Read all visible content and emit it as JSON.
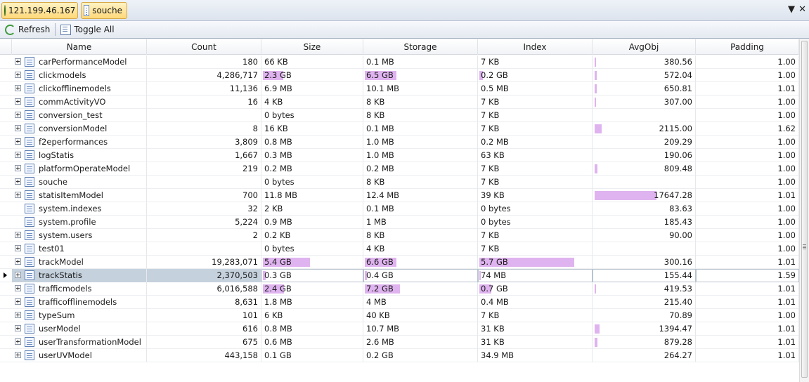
{
  "tabs": [
    {
      "label": "121.199.46.167",
      "icon": "server-globe-icon"
    },
    {
      "label": "souche",
      "icon": "database-icon"
    }
  ],
  "toolbar": {
    "refresh_label": "Refresh",
    "toggle_all_label": "Toggle All"
  },
  "columns": [
    "Name",
    "Count",
    "Size",
    "Storage",
    "Index",
    "AvgObj",
    "Padding"
  ],
  "selected_row": "trackStatis",
  "colors": {
    "bar": "#dfb3ef",
    "selected_row": "#c5d1dd",
    "tab_active": "#ffd97a"
  },
  "rows": [
    {
      "name": "carPerformanceModel",
      "count": "180",
      "size": "66 KB",
      "storage": "0.1 MB",
      "index": "7 KB",
      "avgobj": "380.56",
      "padding": "1.00",
      "expandable": true
    },
    {
      "name": "clickmodels",
      "count": "4,286,717",
      "size": "2.3 GB",
      "storage": "6.5 GB",
      "index": "0.2 GB",
      "avgobj": "572.04",
      "padding": "1.00",
      "expandable": true
    },
    {
      "name": "clickofflinemodels",
      "count": "11,136",
      "size": "6.9 MB",
      "storage": "10.1 MB",
      "index": "0.5 MB",
      "avgobj": "650.81",
      "padding": "1.01",
      "expandable": true
    },
    {
      "name": "commActivityVO",
      "count": "16",
      "size": "4 KB",
      "storage": "8 KB",
      "index": "7 KB",
      "avgobj": "307.00",
      "padding": "1.00",
      "expandable": true
    },
    {
      "name": "conversion_test",
      "count": "",
      "size": "0 bytes",
      "storage": "8 KB",
      "index": "7 KB",
      "avgobj": "",
      "padding": "1.00",
      "expandable": true
    },
    {
      "name": "conversionModel",
      "count": "8",
      "size": "16 KB",
      "storage": "0.1 MB",
      "index": "7 KB",
      "avgobj": "2115.00",
      "padding": "1.62",
      "expandable": true
    },
    {
      "name": "f2eperformances",
      "count": "3,809",
      "size": "0.8 MB",
      "storage": "1.0 MB",
      "index": "0.2 MB",
      "avgobj": "209.29",
      "padding": "1.00",
      "expandable": true
    },
    {
      "name": "logStatis",
      "count": "1,667",
      "size": "0.3 MB",
      "storage": "1.0 MB",
      "index": "63 KB",
      "avgobj": "190.06",
      "padding": "1.00",
      "expandable": true
    },
    {
      "name": "platformOperateModel",
      "count": "219",
      "size": "0.2 MB",
      "storage": "0.2 MB",
      "index": "7 KB",
      "avgobj": "809.48",
      "padding": "1.00",
      "expandable": true
    },
    {
      "name": "souche",
      "count": "",
      "size": "0 bytes",
      "storage": "8 KB",
      "index": "7 KB",
      "avgobj": "",
      "padding": "1.00",
      "expandable": true
    },
    {
      "name": "statisItemModel",
      "count": "700",
      "size": "11.8 MB",
      "storage": "12.4 MB",
      "index": "39 KB",
      "avgobj": "17647.28",
      "padding": "1.01",
      "expandable": true
    },
    {
      "name": "system.indexes",
      "count": "32",
      "size": "2 KB",
      "storage": "0.1 MB",
      "index": "0 bytes",
      "avgobj": "83.63",
      "padding": "1.00",
      "expandable": false
    },
    {
      "name": "system.profile",
      "count": "5,224",
      "size": "0.9 MB",
      "storage": "1 MB",
      "index": "0 bytes",
      "avgobj": "185.43",
      "padding": "1.00",
      "expandable": false
    },
    {
      "name": "system.users",
      "count": "2",
      "size": "0.2 KB",
      "storage": "8 KB",
      "index": "7 KB",
      "avgobj": "90.00",
      "padding": "1.00",
      "expandable": true
    },
    {
      "name": "test01",
      "count": "",
      "size": "0 bytes",
      "storage": "4 KB",
      "index": "7 KB",
      "avgobj": "",
      "padding": "1.00",
      "expandable": true
    },
    {
      "name": "trackModel",
      "count": "19,283,071",
      "size": "5.4 GB",
      "storage": "6.6 GB",
      "index": "5.7 GB",
      "avgobj": "300.16",
      "padding": "1.01",
      "expandable": true
    },
    {
      "name": "trackStatis",
      "count": "2,370,503",
      "size": "0.3 GB",
      "storage": "0.4 GB",
      "index": "74 MB",
      "avgobj": "155.44",
      "padding": "1.59",
      "expandable": true
    },
    {
      "name": "trafficmodels",
      "count": "6,016,588",
      "size": "2.4 GB",
      "storage": "7.2 GB",
      "index": "0.7 GB",
      "avgobj": "419.53",
      "padding": "1.01",
      "expandable": true
    },
    {
      "name": "trafficofflinemodels",
      "count": "8,631",
      "size": "1.8 MB",
      "storage": "4 MB",
      "index": "0.4 MB",
      "avgobj": "215.40",
      "padding": "1.01",
      "expandable": true
    },
    {
      "name": "typeSum",
      "count": "101",
      "size": "6 KB",
      "storage": "40 KB",
      "index": "7 KB",
      "avgobj": "70.89",
      "padding": "1.00",
      "expandable": true
    },
    {
      "name": "userModel",
      "count": "616",
      "size": "0.8 MB",
      "storage": "10.7 MB",
      "index": "31 KB",
      "avgobj": "1394.47",
      "padding": "1.01",
      "expandable": true
    },
    {
      "name": "userTransformationModel",
      "count": "675",
      "size": "0.6 MB",
      "storage": "2.6 MB",
      "index": "31 KB",
      "avgobj": "879.28",
      "padding": "1.01",
      "expandable": true
    },
    {
      "name": "userUVModel",
      "count": "443,158",
      "size": "0.1 GB",
      "storage": "0.2 GB",
      "index": "34.9 MB",
      "avgobj": "264.27",
      "padding": "1.01",
      "expandable": true
    }
  ]
}
